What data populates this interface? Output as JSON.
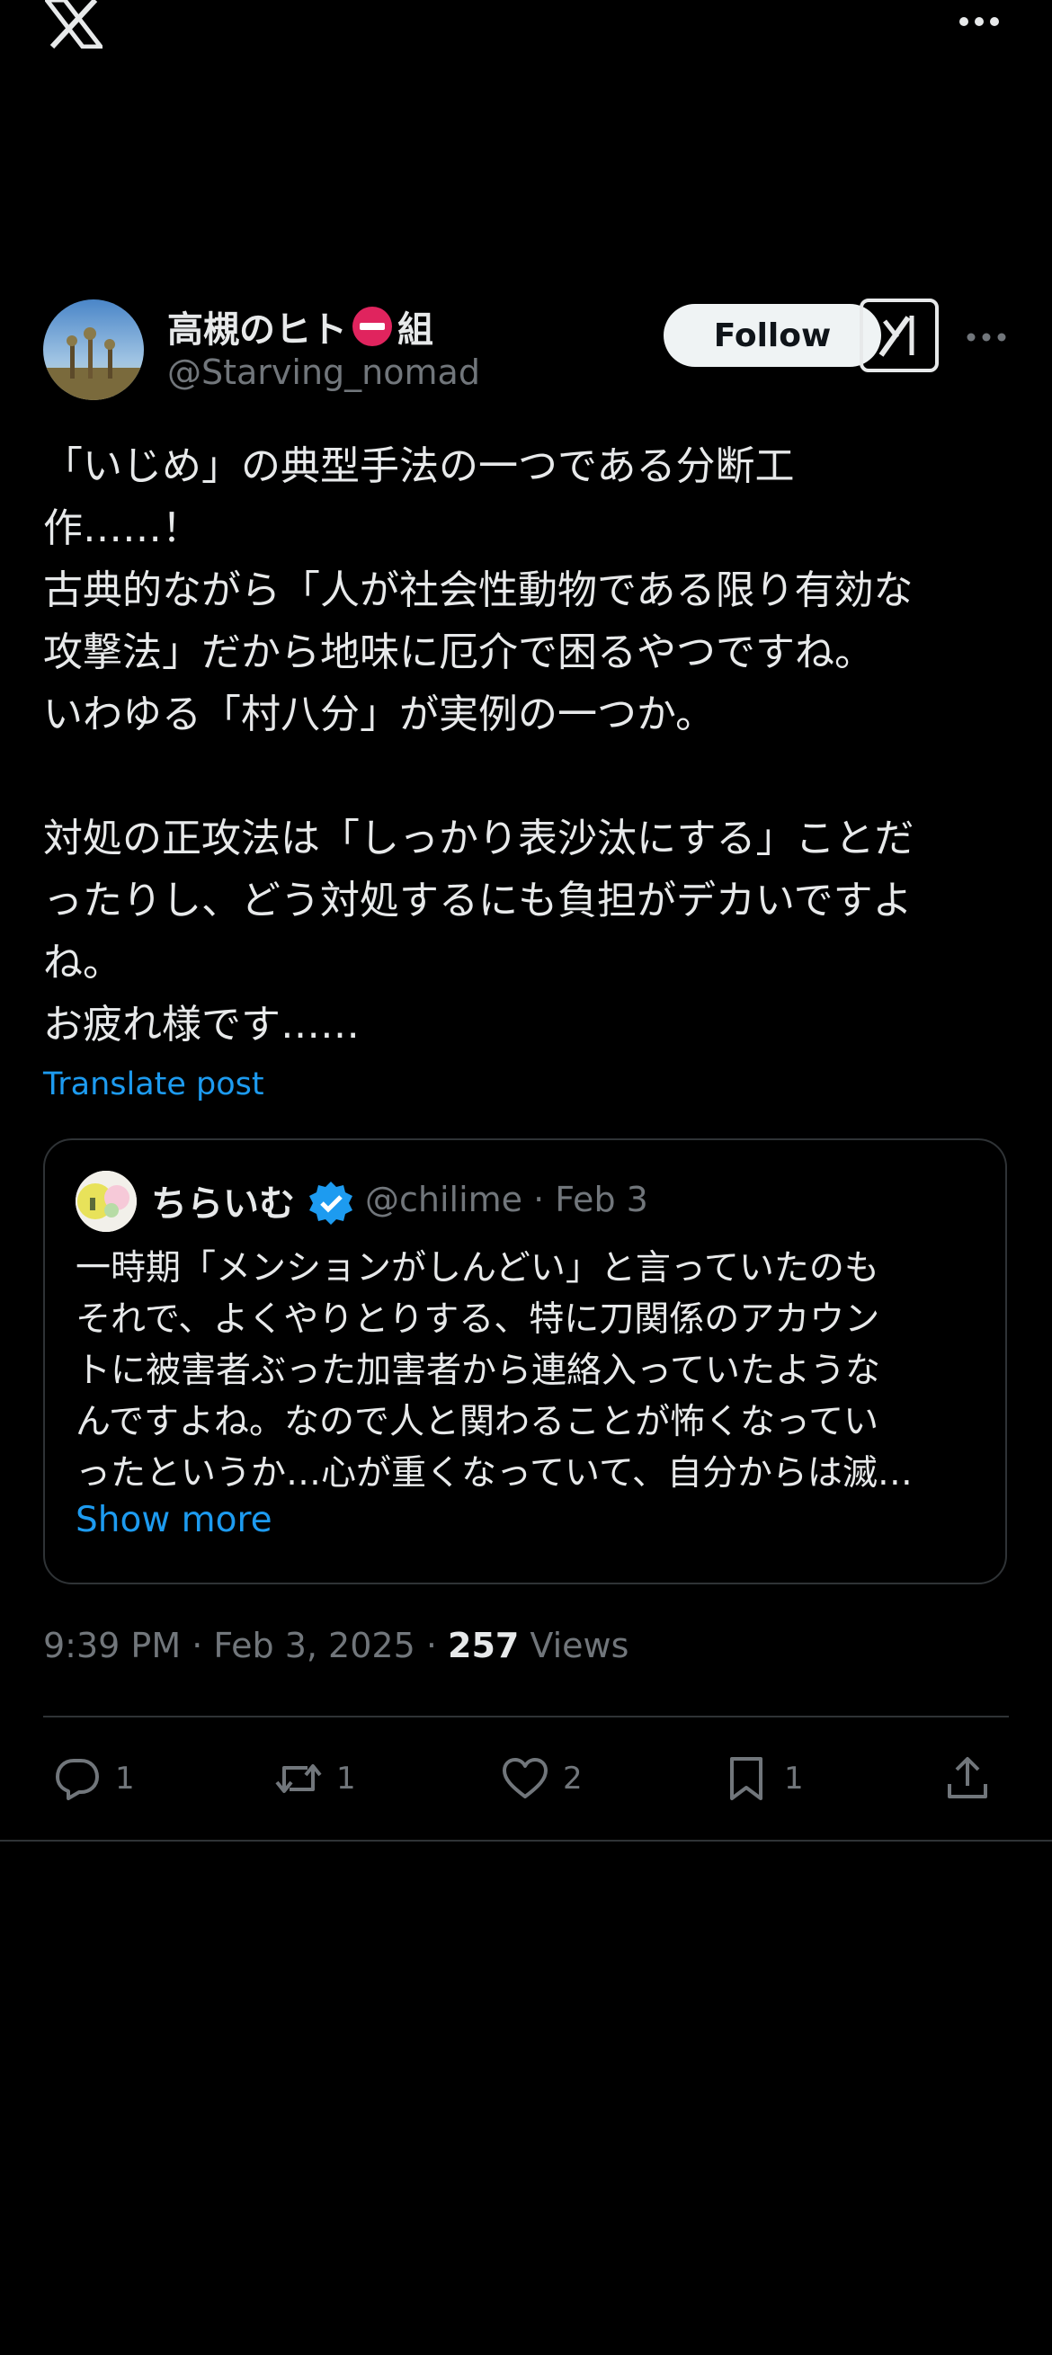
{
  "app": {
    "logo": "x-logo-icon"
  },
  "post": {
    "author_name": "高槻のヒト",
    "author_name_suffix": "組",
    "author_handle": "@Starving_nomad",
    "follow_label": "Follow",
    "text": "「いじめ」の典型手法の一つである分断工\n作……！\n古典的ながら「人が社会性動物である限り有効な\n攻撃法」だから地味に厄介で困るやつですね。\nいわゆる「村八分」が実例の一つか。\n\n対処の正攻法は「しっかり表沙汰にする」ことだ\nったりし、どう対処するにも負担がデカいですよ\nね。\nお疲れ様です……",
    "translate_label": "Translate post",
    "time": "9:39 PM · Feb 3, 2025 · ",
    "views_count": "257",
    "views_label": " Views"
  },
  "quote": {
    "name": "ちらいむ",
    "handle_date": "@chilime · Feb 3",
    "text": "一時期「メンションがしんどい」と言っていたのも\nそれで、よくやりとりする、特に刀関係のアカウン\nトに被害者ぶった加害者から連絡入っていたような\nんですよね。なので人と関わることが怖くなってい\nったというか…心が重くなっていて、自分からは滅…",
    "show_more_label": "Show more"
  },
  "actions": {
    "replies": "1",
    "reposts": "1",
    "likes": "2",
    "bookmarks": "1"
  },
  "colors": {
    "background": "#000000",
    "text": "#e7e9ea",
    "secondary": "#71767b",
    "link": "#1d9bf0",
    "border": "#2f3336",
    "verified": "#1d9bf0"
  }
}
